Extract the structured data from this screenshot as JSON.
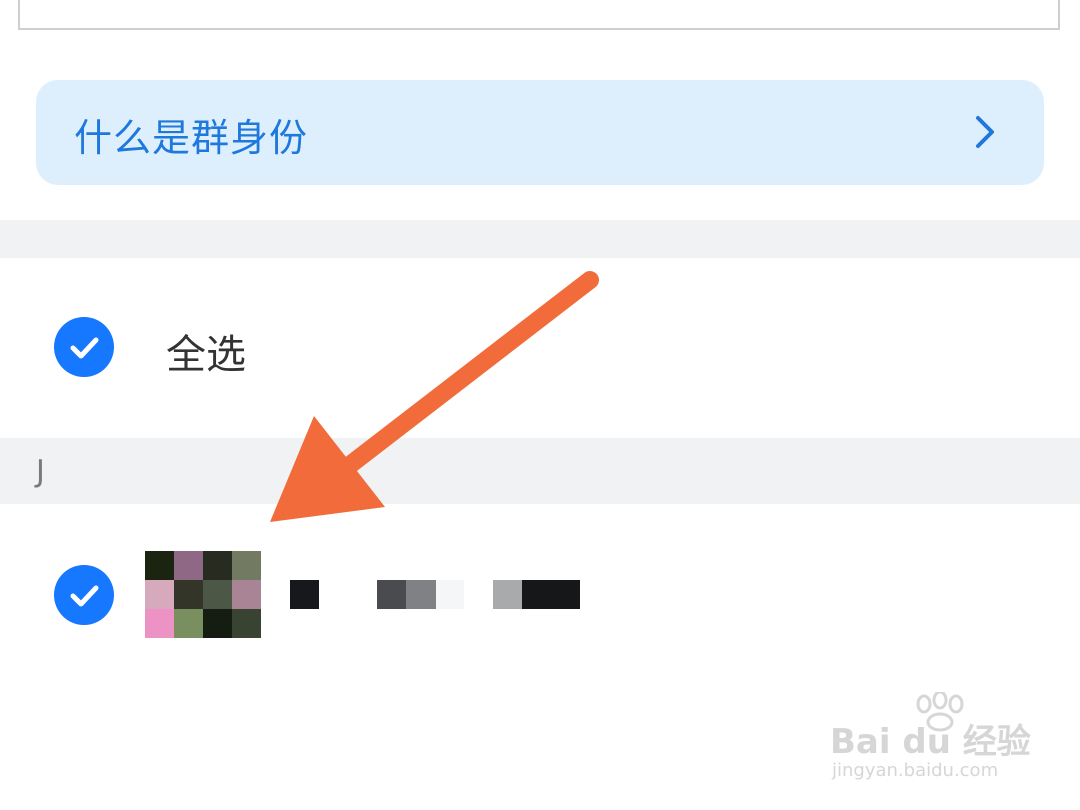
{
  "info_card": {
    "label": "什么是群身份",
    "icon": "chevron-right-icon"
  },
  "select_all": {
    "label": "全选",
    "checked": true
  },
  "section": {
    "letter": "J"
  },
  "member": {
    "checked": true,
    "avatar": "pixelated-avatar",
    "name": "",
    "avatar_colors": [
      "#1b2410",
      "#8e6885",
      "#272b20",
      "#737a62",
      "#d6a9bd",
      "#323527",
      "#4c5746",
      "#a88494",
      "#ec92c5",
      "#7a8f60",
      "#151c12",
      "#384331"
    ]
  },
  "colors": {
    "accent": "#1677ff",
    "arrow": "#f26b3a",
    "card_bg": "#ddeffd",
    "band": "#f1f2f4"
  },
  "watermark": {
    "brand": "Bai du 经验",
    "url": "jingyan.baidu.com"
  }
}
